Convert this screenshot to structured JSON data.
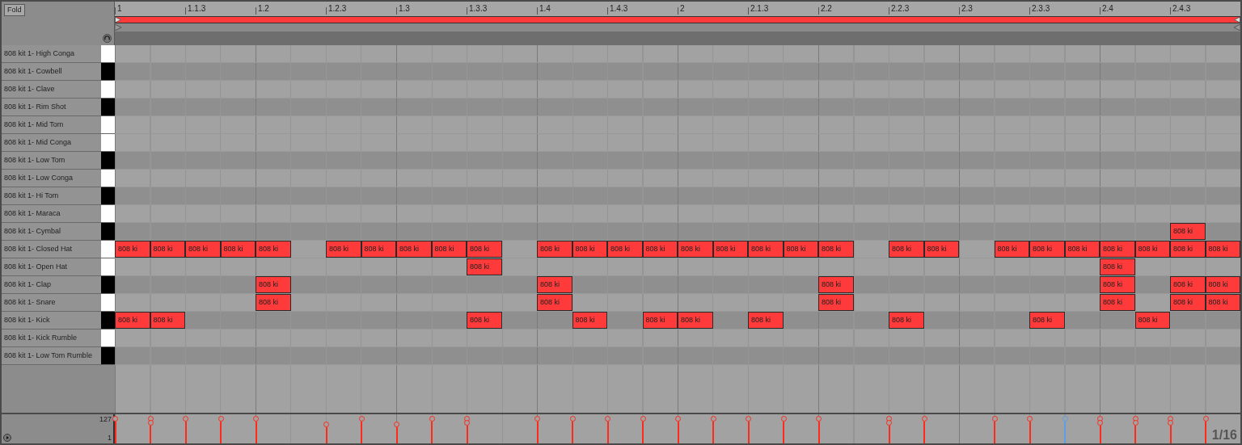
{
  "fold_button": "Fold",
  "ruler": [
    "1",
    "1.1.3",
    "1.2",
    "1.2.3",
    "1.3",
    "1.3.3",
    "1.4",
    "1.4.3",
    "2",
    "2.1.3",
    "2.2",
    "2.2.3",
    "2.3",
    "2.3.3",
    "2.4",
    "2.4.3"
  ],
  "rows": [
    {
      "name": "808 kit 1- High Conga",
      "kind": "natural"
    },
    {
      "name": "808 kit 1- Cowbell",
      "kind": "sharp"
    },
    {
      "name": "808 kit 1- Clave",
      "kind": "natural"
    },
    {
      "name": "808 kit 1- Rim Shot",
      "kind": "sharp"
    },
    {
      "name": "808 kit 1- Mid Tom",
      "kind": "natural"
    },
    {
      "name": "808 kit 1- Mid Conga",
      "kind": "natural"
    },
    {
      "name": "808 kit 1- Low Tom",
      "kind": "sharp"
    },
    {
      "name": "808 kit 1- Low Conga",
      "kind": "natural"
    },
    {
      "name": "808 kit 1- Hi Tom",
      "kind": "sharp"
    },
    {
      "name": "808 kit 1- Maraca",
      "kind": "natural"
    },
    {
      "name": "808 kit 1- Cymbal",
      "kind": "sharp",
      "notes": [
        {
          "on": false
        },
        {
          "on": false
        },
        {
          "on": false
        },
        {
          "on": false
        },
        {
          "on": false
        },
        {
          "on": false
        },
        {
          "on": false
        },
        {
          "on": false
        },
        {
          "on": false
        },
        {
          "on": false
        },
        {
          "on": false
        },
        {
          "on": false
        },
        {
          "on": false
        },
        {
          "on": false
        },
        {
          "on": false
        },
        {
          "on": false
        },
        {
          "on": false
        },
        {
          "on": false
        },
        {
          "on": false
        },
        {
          "on": false
        },
        {
          "on": false
        },
        {
          "on": false
        },
        {
          "on": false
        },
        {
          "on": false
        },
        {
          "on": false
        },
        {
          "on": false
        },
        {
          "on": false
        },
        {
          "on": false
        },
        {
          "on": false
        },
        {
          "on": false
        },
        {
          "on": true,
          "label": "808 ki"
        },
        {
          "on": false
        }
      ]
    },
    {
      "name": "808 kit 1- Closed Hat",
      "kind": "natural",
      "notes": [
        {
          "on": true,
          "label": "808 ki"
        },
        {
          "on": true,
          "label": "808 ki"
        },
        {
          "on": true,
          "label": "808 ki"
        },
        {
          "on": true,
          "label": "808 ki"
        },
        {
          "on": true,
          "label": "808 ki"
        },
        {
          "on": false
        },
        {
          "on": true,
          "label": "808 ki"
        },
        {
          "on": true,
          "label": "808 ki"
        },
        {
          "on": true,
          "label": "808 ki"
        },
        {
          "on": true,
          "label": "808 ki"
        },
        {
          "on": true,
          "label": "808 ki"
        },
        {
          "on": false
        },
        {
          "on": true,
          "label": "808 ki"
        },
        {
          "on": true,
          "label": "808 ki"
        },
        {
          "on": true,
          "label": "808 ki"
        },
        {
          "on": true,
          "label": "808 ki"
        },
        {
          "on": true,
          "label": "808 ki"
        },
        {
          "on": true,
          "label": "808 ki"
        },
        {
          "on": true,
          "label": "808 ki"
        },
        {
          "on": true,
          "label": "808 ki"
        },
        {
          "on": true,
          "label": "808 ki"
        },
        {
          "on": false
        },
        {
          "on": true,
          "label": "808 ki"
        },
        {
          "on": true,
          "label": "808 ki"
        },
        {
          "on": false
        },
        {
          "on": true,
          "label": "808 ki"
        },
        {
          "on": true,
          "label": "808 ki"
        },
        {
          "on": true,
          "label": "808 ki"
        },
        {
          "on": true,
          "label": "808 ki"
        },
        {
          "on": true,
          "label": "808 ki"
        },
        {
          "on": true,
          "label": "808 ki"
        },
        {
          "on": true,
          "label": "808 ki"
        }
      ]
    },
    {
      "name": "808 kit 1- Open Hat",
      "kind": "natural",
      "notes": [
        {
          "on": false
        },
        {
          "on": false
        },
        {
          "on": false
        },
        {
          "on": false
        },
        {
          "on": false
        },
        {
          "on": false
        },
        {
          "on": false
        },
        {
          "on": false
        },
        {
          "on": false
        },
        {
          "on": false
        },
        {
          "on": true,
          "label": "808 ki"
        },
        {
          "on": false
        },
        {
          "on": false
        },
        {
          "on": false
        },
        {
          "on": false
        },
        {
          "on": false
        },
        {
          "on": false
        },
        {
          "on": false
        },
        {
          "on": false
        },
        {
          "on": false
        },
        {
          "on": false
        },
        {
          "on": false
        },
        {
          "on": false
        },
        {
          "on": false
        },
        {
          "on": false
        },
        {
          "on": false
        },
        {
          "on": false
        },
        {
          "on": false
        },
        {
          "on": true,
          "label": "808 ki"
        },
        {
          "on": false
        },
        {
          "on": false
        },
        {
          "on": false
        }
      ]
    },
    {
      "name": "808 kit 1- Clap",
      "kind": "sharp",
      "notes": [
        {
          "on": false
        },
        {
          "on": false
        },
        {
          "on": false
        },
        {
          "on": false
        },
        {
          "on": true,
          "label": "808 ki"
        },
        {
          "on": false
        },
        {
          "on": false
        },
        {
          "on": false
        },
        {
          "on": false
        },
        {
          "on": false
        },
        {
          "on": false
        },
        {
          "on": false
        },
        {
          "on": true,
          "label": "808 ki"
        },
        {
          "on": false
        },
        {
          "on": false
        },
        {
          "on": false
        },
        {
          "on": false
        },
        {
          "on": false
        },
        {
          "on": false
        },
        {
          "on": false
        },
        {
          "on": true,
          "label": "808 ki"
        },
        {
          "on": false
        },
        {
          "on": false
        },
        {
          "on": false
        },
        {
          "on": false
        },
        {
          "on": false
        },
        {
          "on": false
        },
        {
          "on": false
        },
        {
          "on": true,
          "label": "808 ki"
        },
        {
          "on": false
        },
        {
          "on": true,
          "label": "808 ki"
        },
        {
          "on": true,
          "label": "808 ki"
        }
      ]
    },
    {
      "name": "808 kit 1- Snare",
      "kind": "natural",
      "notes": [
        {
          "on": false
        },
        {
          "on": false
        },
        {
          "on": false
        },
        {
          "on": false
        },
        {
          "on": true,
          "label": "808 ki"
        },
        {
          "on": false
        },
        {
          "on": false
        },
        {
          "on": false
        },
        {
          "on": false
        },
        {
          "on": false
        },
        {
          "on": false
        },
        {
          "on": false
        },
        {
          "on": true,
          "label": "808 ki"
        },
        {
          "on": false
        },
        {
          "on": false
        },
        {
          "on": false
        },
        {
          "on": false
        },
        {
          "on": false
        },
        {
          "on": false
        },
        {
          "on": false
        },
        {
          "on": true,
          "label": "808 ki"
        },
        {
          "on": false
        },
        {
          "on": false
        },
        {
          "on": false
        },
        {
          "on": false
        },
        {
          "on": false
        },
        {
          "on": false
        },
        {
          "on": false
        },
        {
          "on": true,
          "label": "808 ki"
        },
        {
          "on": false
        },
        {
          "on": true,
          "label": "808 ki"
        },
        {
          "on": true,
          "label": "808 ki"
        }
      ]
    },
    {
      "name": "808 kit 1- Kick",
      "kind": "sharp",
      "notes": [
        {
          "on": true,
          "label": "808 ki"
        },
        {
          "on": true,
          "label": "808 ki"
        },
        {
          "on": false
        },
        {
          "on": false
        },
        {
          "on": false
        },
        {
          "on": false
        },
        {
          "on": false
        },
        {
          "on": false
        },
        {
          "on": false
        },
        {
          "on": false
        },
        {
          "on": true,
          "label": "808 ki"
        },
        {
          "on": false
        },
        {
          "on": false
        },
        {
          "on": true,
          "label": "808 ki"
        },
        {
          "on": false
        },
        {
          "on": true,
          "label": "808 ki"
        },
        {
          "on": true,
          "label": "808 ki"
        },
        {
          "on": false
        },
        {
          "on": true,
          "label": "808 ki"
        },
        {
          "on": false
        },
        {
          "on": false
        },
        {
          "on": false
        },
        {
          "on": true,
          "label": "808 ki"
        },
        {
          "on": false
        },
        {
          "on": false
        },
        {
          "on": false
        },
        {
          "on": true,
          "label": "808 ki"
        },
        {
          "on": false
        },
        {
          "on": false
        },
        {
          "on": true,
          "label": "808 ki"
        },
        {
          "on": false
        },
        {
          "on": false
        }
      ]
    },
    {
      "name": "808 kit 1- Kick Rumble",
      "kind": "natural"
    },
    {
      "name": "808 kit 1- Low Tom Rumble",
      "kind": "sharp"
    }
  ],
  "velocity": {
    "max": "127",
    "min": "1",
    "grid": "1/16",
    "markers": [
      {
        "on": true,
        "kind": "full",
        "stacked": false,
        "selected": false
      },
      {
        "on": true,
        "kind": "full",
        "stacked": true,
        "selected": false
      },
      {
        "on": true,
        "kind": "full",
        "stacked": false,
        "selected": false
      },
      {
        "on": true,
        "kind": "full",
        "stacked": false,
        "selected": false
      },
      {
        "on": true,
        "kind": "full",
        "stacked": false,
        "selected": false
      },
      {
        "on": false
      },
      {
        "on": true,
        "kind": "lower",
        "stacked": false,
        "selected": false
      },
      {
        "on": true,
        "kind": "full",
        "stacked": false,
        "selected": false
      },
      {
        "on": true,
        "kind": "lower",
        "stacked": false,
        "selected": false
      },
      {
        "on": true,
        "kind": "full",
        "stacked": false,
        "selected": false
      },
      {
        "on": true,
        "kind": "full",
        "stacked": true,
        "selected": false
      },
      {
        "on": false
      },
      {
        "on": true,
        "kind": "full",
        "stacked": false,
        "selected": false
      },
      {
        "on": true,
        "kind": "full",
        "stacked": false,
        "selected": false
      },
      {
        "on": true,
        "kind": "full",
        "stacked": false,
        "selected": false
      },
      {
        "on": true,
        "kind": "full",
        "stacked": false,
        "selected": false
      },
      {
        "on": true,
        "kind": "full",
        "stacked": false,
        "selected": false
      },
      {
        "on": true,
        "kind": "full",
        "stacked": false,
        "selected": false
      },
      {
        "on": true,
        "kind": "full",
        "stacked": false,
        "selected": false
      },
      {
        "on": true,
        "kind": "full",
        "stacked": false,
        "selected": false
      },
      {
        "on": true,
        "kind": "full",
        "stacked": false,
        "selected": false
      },
      {
        "on": false
      },
      {
        "on": true,
        "kind": "full",
        "stacked": true,
        "selected": false
      },
      {
        "on": true,
        "kind": "full",
        "stacked": false,
        "selected": false
      },
      {
        "on": false
      },
      {
        "on": true,
        "kind": "full",
        "stacked": false,
        "selected": false
      },
      {
        "on": true,
        "kind": "full",
        "stacked": false,
        "selected": false
      },
      {
        "on": true,
        "kind": "full",
        "stacked": false,
        "selected": true
      },
      {
        "on": true,
        "kind": "full",
        "stacked": true,
        "selected": false
      },
      {
        "on": true,
        "kind": "full",
        "stacked": true,
        "selected": false
      },
      {
        "on": true,
        "kind": "full",
        "stacked": true,
        "selected": false
      },
      {
        "on": true,
        "kind": "full",
        "stacked": false,
        "selected": false
      }
    ]
  }
}
